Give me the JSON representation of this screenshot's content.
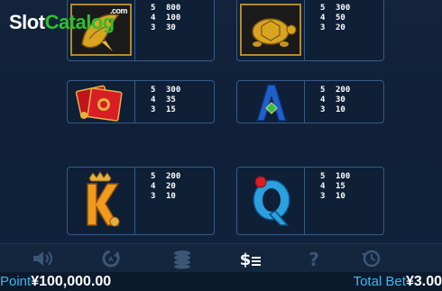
{
  "watermark": {
    "slot": "Slot",
    "catalog": "Catalog",
    "com": ".com"
  },
  "paytable": [
    {
      "symbol": "koi-fish",
      "pays": [
        {
          "n": "5",
          "v": "800"
        },
        {
          "n": "4",
          "v": "100"
        },
        {
          "n": "3",
          "v": "30"
        }
      ]
    },
    {
      "symbol": "golden-turtle",
      "pays": [
        {
          "n": "5",
          "v": "300"
        },
        {
          "n": "4",
          "v": "50"
        },
        {
          "n": "3",
          "v": "20"
        }
      ]
    },
    {
      "symbol": "red-envelopes",
      "pays": [
        {
          "n": "5",
          "v": "300"
        },
        {
          "n": "4",
          "v": "35"
        },
        {
          "n": "3",
          "v": "15"
        }
      ]
    },
    {
      "symbol": "letter-a",
      "pays": [
        {
          "n": "5",
          "v": "200"
        },
        {
          "n": "4",
          "v": "30"
        },
        {
          "n": "3",
          "v": "10"
        }
      ]
    },
    {
      "symbol": "letter-k",
      "pays": [
        {
          "n": "5",
          "v": "200"
        },
        {
          "n": "4",
          "v": "20"
        },
        {
          "n": "3",
          "v": "10"
        }
      ]
    },
    {
      "symbol": "letter-q",
      "pays": [
        {
          "n": "5",
          "v": "100"
        },
        {
          "n": "4",
          "v": "15"
        },
        {
          "n": "3",
          "v": "10"
        }
      ]
    }
  ],
  "toolbar": {
    "icons": [
      "sound-icon",
      "autoplay-icon",
      "coins-icon",
      "paytable-icon",
      "help-icon",
      "history-icon"
    ],
    "active": "paytable-icon",
    "active_color": "#ffffff",
    "inactive_color": "#3d5675"
  },
  "status": {
    "point_label": "Point",
    "point_value": "¥100,000.00",
    "bet_label": "Total Bet",
    "bet_value": "¥3.00"
  }
}
